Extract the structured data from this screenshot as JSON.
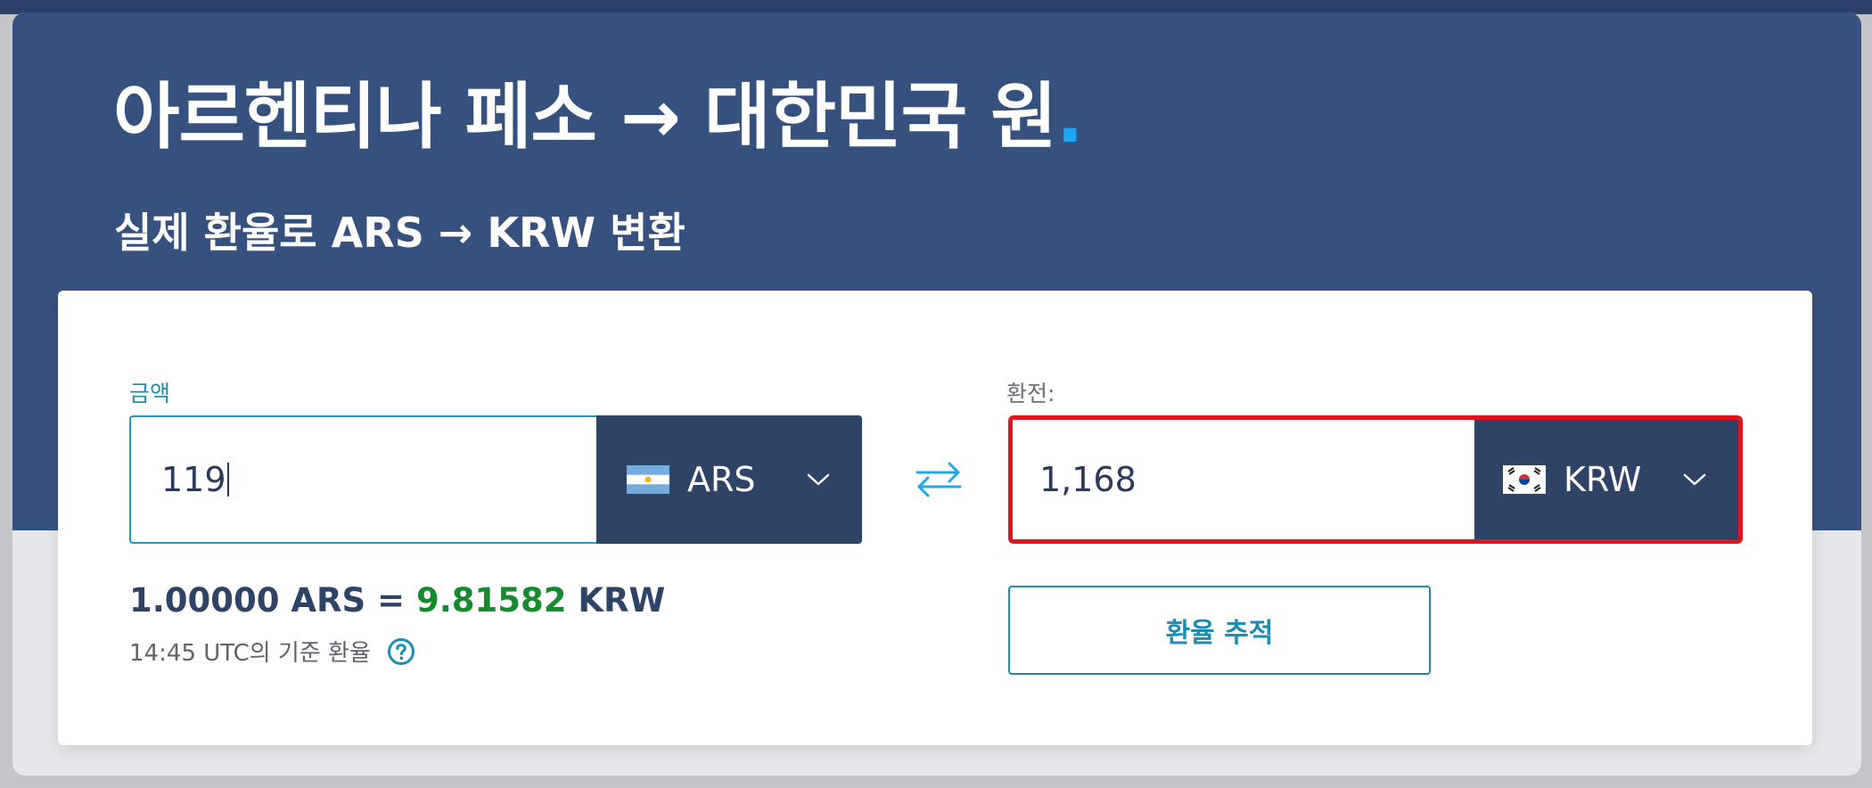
{
  "header": {
    "title": "아르헨티나 페소 → 대한민국 원",
    "title_dot": ".",
    "subtitle": "실제 환율로 ARS → KRW 변환"
  },
  "amount": {
    "label": "금액",
    "value": "119",
    "currency": "ARS",
    "flag_icon": "argentina-flag-icon"
  },
  "converted": {
    "label": "환전:",
    "value": "1,168",
    "currency": "KRW",
    "flag_icon": "south-korea-flag-icon"
  },
  "rate": {
    "left": "1.00000 ARS = ",
    "value": "9.81582",
    "right": " KRW",
    "note": "14:45 UTC의 기준 환율"
  },
  "actions": {
    "track_label": "환율 추적"
  },
  "icons": {
    "swap": "swap-arrows-icon",
    "chevron": "chevron-down-icon",
    "help": "help-icon"
  },
  "colors": {
    "hero_background": "#37517e",
    "accent": "#1a8db0",
    "select_background": "#2f4367",
    "rate_value": "#168a2e",
    "highlight_border": "#e0141f"
  }
}
